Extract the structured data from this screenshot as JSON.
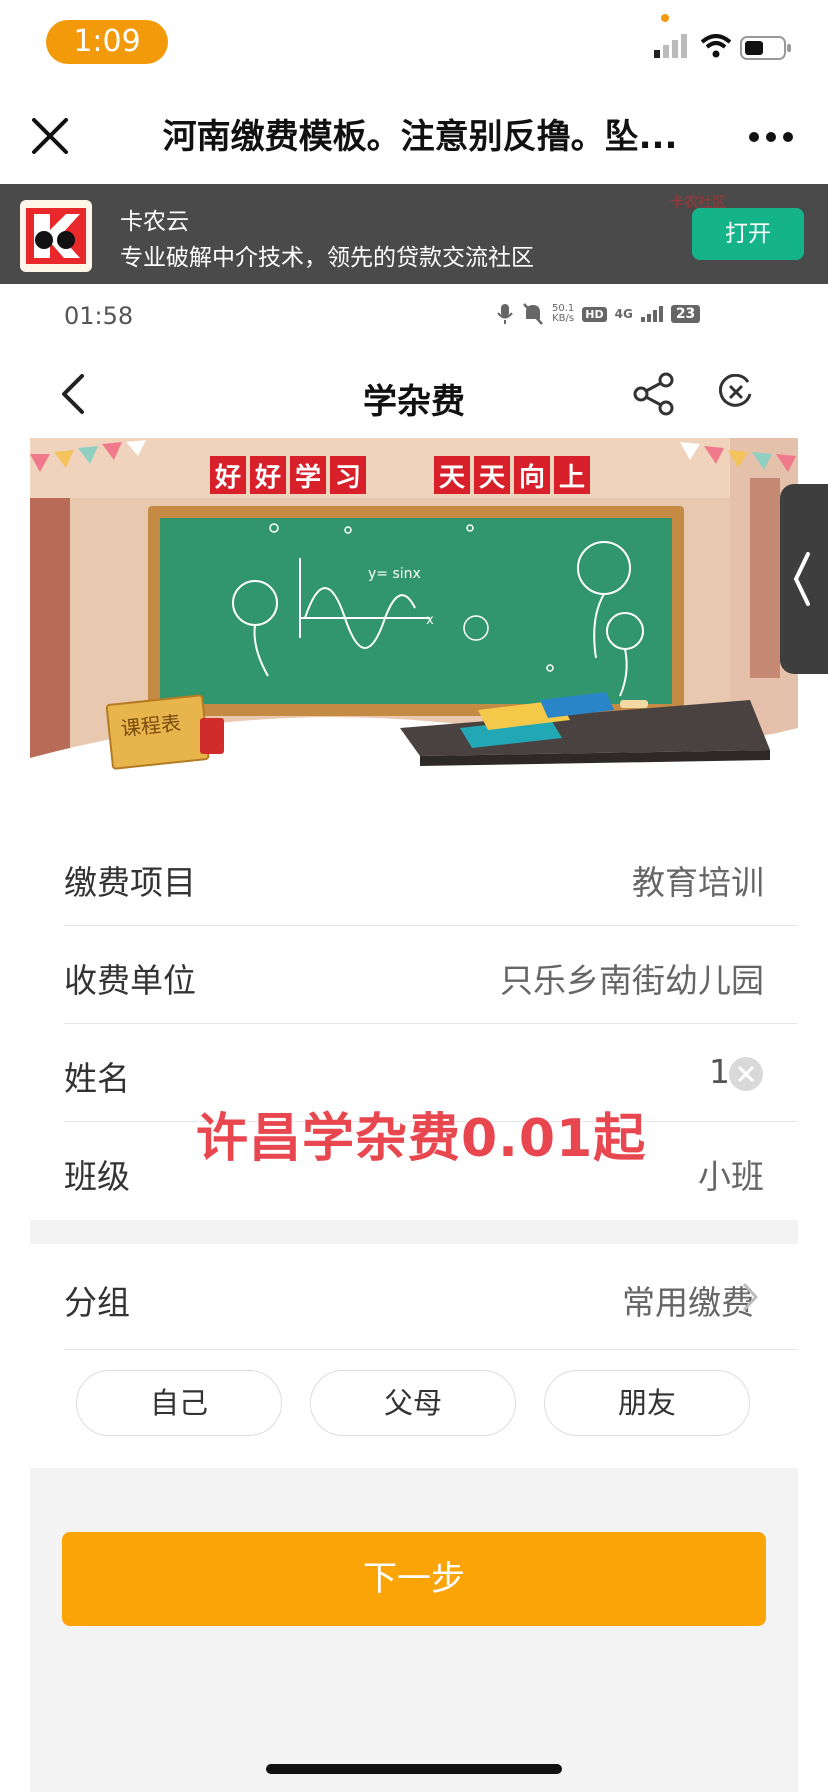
{
  "ios_status": {
    "time": "1:09"
  },
  "browser": {
    "title": "河南缴费模板。注意别反撸。坠..."
  },
  "app_banner": {
    "name": "卡农云",
    "description": "专业破解中介技术，领先的贷款交流社区",
    "open_label": "打开",
    "watermark": "卡农社区"
  },
  "inner_status": {
    "time": "01:58",
    "speed_value": "50.1",
    "speed_unit": "KB/s",
    "hd": "HD",
    "network": "4G",
    "battery": "23"
  },
  "page": {
    "title": "学杂费"
  },
  "hero": {
    "banner_chars": [
      "好",
      "好",
      "学",
      "习",
      "天",
      "天",
      "向",
      "上"
    ],
    "formula": "y= sinx",
    "axis_x": "x",
    "schedule_sign": "课程表"
  },
  "form": {
    "rows": [
      {
        "label": "缴费项目",
        "value": "教育培训"
      },
      {
        "label": "收费单位",
        "value": "只乐乡南街幼儿园"
      },
      {
        "label": "姓名",
        "value": "1"
      },
      {
        "label": "班级",
        "value": "小班"
      }
    ],
    "group": {
      "label": "分组",
      "value": "常用缴费"
    },
    "chips": [
      "自己",
      "父母",
      "朋友"
    ]
  },
  "overlay_slogan": "许昌学杂费0.01起",
  "actions": {
    "next_label": "下一步"
  },
  "colors": {
    "accent": "#fba408",
    "banner_green": "#14b38a",
    "slogan_red": "#e8474f"
  }
}
